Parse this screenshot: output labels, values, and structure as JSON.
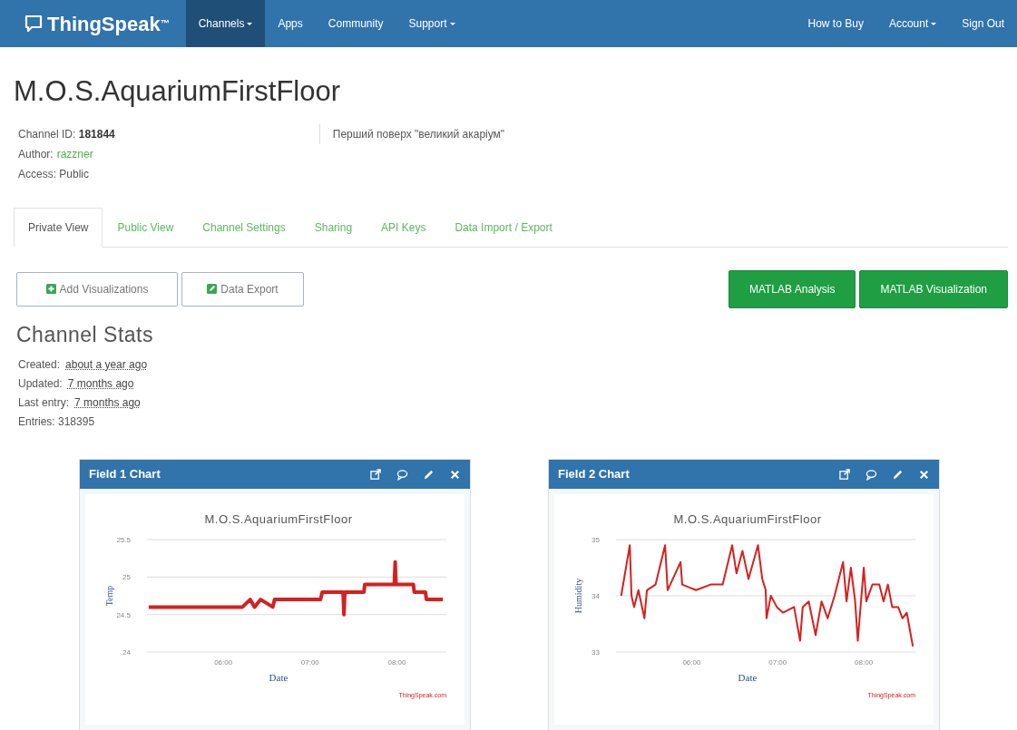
{
  "navbar": {
    "logo": "ThingSpeak$^{™}$",
    "items": [
      {
        "label": "Channels",
        "dropdown": true,
        "selected": true
      },
      {
        "label": "Apps",
        "dropdown": false,
        "selected": false
      },
      {
        "label": "Community",
        "dropdown": false,
        "selected": false
      },
      {
        "label": "Support",
        "dropdown": true,
        "selected": false
      }
    ],
    "right_items": [
      {
        "label": "How to Buy",
        "dropdown": false
      },
      {
        "label": "Account",
        "dropdown": true
      },
      {
        "label": "Sign Out",
        "dropdown": false
      }
    ]
  },
  "channel": {
    "title": "M.O.S.AquariumFirstFloor",
    "id_label": "Channel ID:",
    "id": "181844",
    "author_label": "Author:",
    "author": "razzner",
    "access": "Access: Public",
    "description": "Перший поверх \"великий акаріум\""
  },
  "tabs": [
    {
      "label": "Private View",
      "selected": true
    },
    {
      "label": "Public View",
      "selected": false
    },
    {
      "label": "Channel Settings",
      "selected": false
    },
    {
      "label": "Sharing",
      "selected": false
    },
    {
      "label": "API Keys",
      "selected": false
    },
    {
      "label": "Data Import / Export",
      "selected": false
    }
  ],
  "actions": [
    {
      "label": "Add Visualizations",
      "kind": "add"
    },
    {
      "label": "Data Export",
      "kind": "export"
    }
  ],
  "matlab_buttons": [
    "MATLAB Analysis",
    "MATLAB Visualization"
  ],
  "stats": {
    "title": "Channel Stats",
    "rows": [
      {
        "label": "Created:",
        "value": "about a year ago"
      },
      {
        "label": "Updated:",
        "value": "7 months ago"
      },
      {
        "label": "Last entry:",
        "value": "7 months ago"
      }
    ],
    "entries": "Entries: 318395"
  },
  "charts": [
    {
      "header": "Field 1 Chart",
      "credits": "ThingSpeak.com",
      "chart_data": {
        "type": "line",
        "title": "M.O.S.AquariumFirstFloor",
        "xlabel": "Date",
        "ylabel": "Temp",
        "xlim": [
          5.12,
          8.57
        ],
        "ylim": [
          24,
          25.5
        ],
        "yticks": [
          {
            "value": 24,
            "label": "24"
          },
          {
            "value": 24.5,
            "label": "24.5"
          },
          {
            "value": 25,
            "label": "25"
          },
          {
            "value": 25.5,
            "label": "25.5"
          }
        ],
        "xticks": [
          {
            "value": 6,
            "label": "06:00"
          },
          {
            "value": 7,
            "label": "07:00"
          },
          {
            "value": 8,
            "label": "08:00"
          }
        ],
        "x": [
          5.14,
          6.22,
          6.31,
          6.36,
          6.43,
          6.57,
          6.59,
          7.12,
          7.14,
          7.38,
          7.39,
          7.4,
          7.62,
          7.63,
          7.97,
          7.98,
          7.99,
          8.19,
          8.2,
          8.33,
          8.34,
          8.53
        ],
        "series": [
          {
            "color": "#d62020",
            "values": [
              24.6,
              24.6,
              24.7,
              24.6,
              24.7,
              24.6,
              24.7,
              24.7,
              24.8,
              24.8,
              24.5,
              24.8,
              24.8,
              24.9,
              24.9,
              25.2,
              24.9,
              24.9,
              24.8,
              24.8,
              24.7,
              24.7
            ]
          }
        ]
      }
    },
    {
      "header": "Field 2 Chart",
      "credits": "ThingSpeak.com",
      "chart_data": {
        "type": "line",
        "title": "M.O.S.AquariumFirstFloor",
        "xlabel": "Date",
        "ylabel": "Humidity",
        "xlim": [
          5.12,
          8.6
        ],
        "ylim": [
          33,
          35
        ],
        "yticks": [
          {
            "value": 33,
            "label": "33"
          },
          {
            "value": 34,
            "label": "34"
          },
          {
            "value": 35,
            "label": "35"
          }
        ],
        "xticks": [
          {
            "value": 6,
            "label": "06:00"
          },
          {
            "value": 7,
            "label": "07:00"
          },
          {
            "value": 8,
            "label": "08:00"
          }
        ],
        "x": [
          5.18,
          5.28,
          5.3,
          5.33,
          5.38,
          5.45,
          5.48,
          5.58,
          5.69,
          5.72,
          5.87,
          5.89,
          6.05,
          6.22,
          6.36,
          6.47,
          6.52,
          6.59,
          6.66,
          6.77,
          6.82,
          6.86,
          6.87,
          6.92,
          6.99,
          7.06,
          7.19,
          7.26,
          7.29,
          7.36,
          7.44,
          7.51,
          7.58,
          7.66,
          7.76,
          7.8,
          7.85,
          7.9,
          7.93,
          8.0,
          8.03,
          8.1,
          8.18,
          8.23,
          8.28,
          8.33,
          8.4,
          8.45,
          8.5,
          8.57
        ],
        "series": [
          {
            "color": "#d62020",
            "values": [
              34.0,
              34.9,
              34.0,
              33.8,
              34.1,
              33.6,
              34.1,
              34.2,
              34.9,
              34.1,
              34.6,
              34.2,
              34.1,
              34.2,
              34.2,
              34.9,
              34.4,
              34.8,
              34.3,
              34.9,
              34.3,
              34.1,
              33.6,
              34.0,
              33.8,
              33.7,
              33.8,
              33.2,
              33.8,
              33.9,
              33.3,
              33.9,
              33.6,
              34.0,
              34.6,
              33.9,
              34.5,
              33.9,
              33.2,
              34.5,
              33.9,
              34.2,
              34.2,
              33.9,
              34.2,
              33.8,
              33.8,
              33.6,
              33.7,
              33.1
            ]
          }
        ]
      }
    }
  ]
}
